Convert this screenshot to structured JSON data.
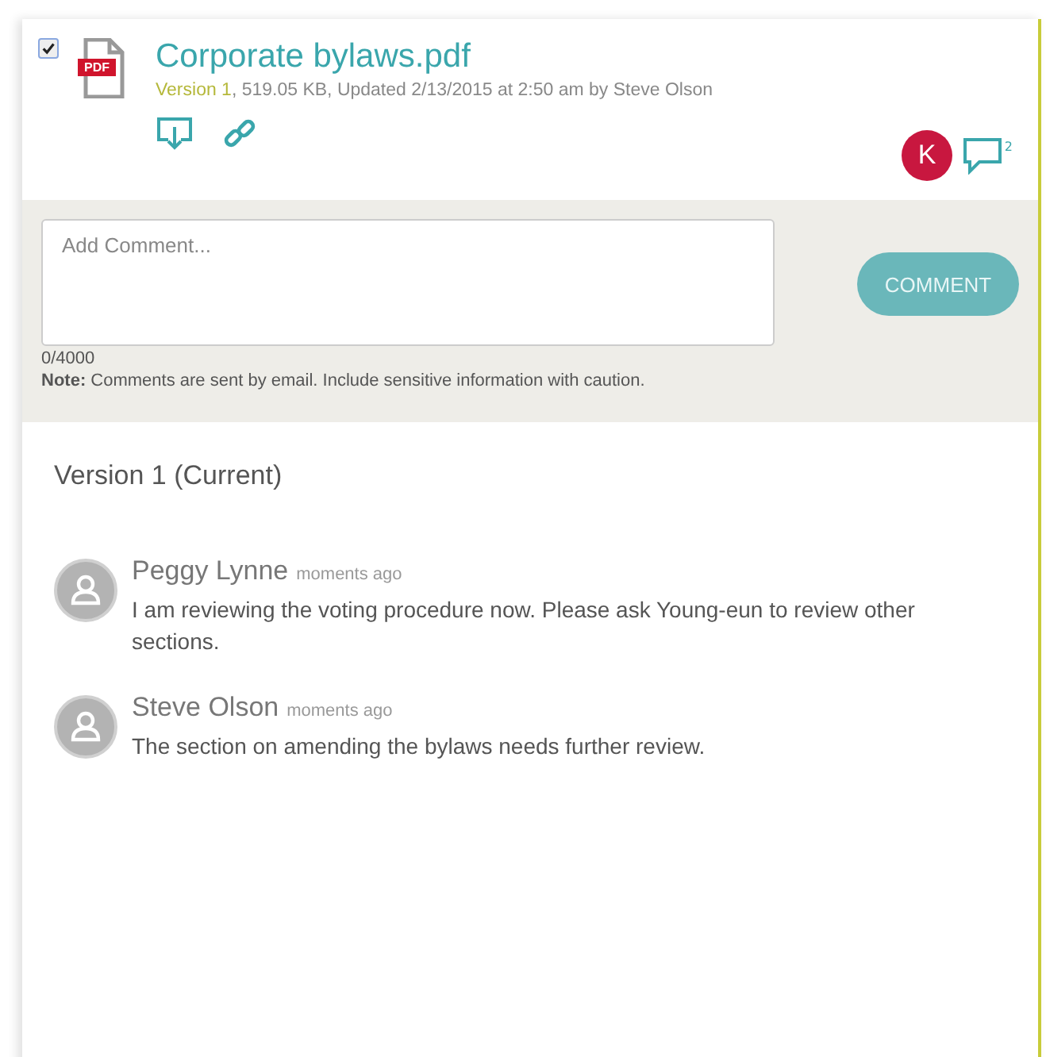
{
  "file": {
    "checked": true,
    "badge": "PDF",
    "name": "Corporate bylaws.pdf",
    "version": "Version 1",
    "details": ", 519.05 KB, Updated 2/13/2015 at 2:50 am by Steve Olson",
    "user_initial": "K",
    "comment_count": "2"
  },
  "composer": {
    "placeholder": "Add Comment...",
    "counter": "0/4000",
    "note": "**Note:** Comments are sent by email. Include sensitive information with caution.",
    "button": "COMMENT"
  },
  "version_heading": "Version 1 (Current)",
  "comments": [
    {
      "author": "Peggy Lynne",
      "time": "moments ago",
      "text": "I am reviewing the voting procedure now. Please ask Young-eun to review other sections."
    },
    {
      "author": "Steve Olson",
      "time": "moments ago",
      "text": "The section on amending the bylaws needs further review."
    }
  ]
}
